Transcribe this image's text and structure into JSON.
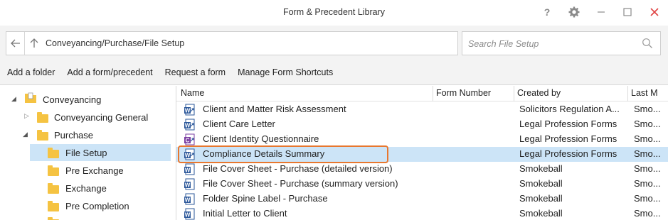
{
  "window": {
    "title": "Form & Precedent Library",
    "controls": [
      "help-icon",
      "gear-icon",
      "minimize-icon",
      "maximize-icon",
      "close-icon"
    ],
    "help_glyph": "?",
    "close_color": "#e04343"
  },
  "address": {
    "path": "Conveyancing/Purchase/File Setup"
  },
  "search": {
    "placeholder": "Search File Setup"
  },
  "actions": [
    "Add a folder",
    "Add a form/precedent",
    "Request a form",
    "Manage Form Shortcuts"
  ],
  "tree": [
    {
      "label": "Conveyancing",
      "expanded": true,
      "selected": false
    },
    {
      "label": "Conveyancing General",
      "expanded": false,
      "selected": false
    },
    {
      "label": "Purchase",
      "expanded": true,
      "selected": false
    },
    {
      "label": "File Setup",
      "selected": true
    },
    {
      "label": "Pre Exchange",
      "selected": false
    },
    {
      "label": "Exchange",
      "selected": false
    },
    {
      "label": "Pre Completion",
      "selected": false
    }
  ],
  "table": {
    "columns": [
      "Name",
      "Form Number",
      "Created by",
      "Last M"
    ],
    "rows": [
      {
        "name": "Client and Matter Risk Assessment",
        "form_number": "",
        "created_by": "Solicitors Regulation A...",
        "last": "Smo...",
        "icon": "word-link-icon",
        "selected": false
      },
      {
        "name": "Client Care Letter",
        "form_number": "",
        "created_by": "Legal Profession Forms",
        "last": "Smo...",
        "icon": "word-link-icon",
        "selected": false
      },
      {
        "name": "Client Identity Questionnaire",
        "form_number": "",
        "created_by": "Legal Profession Forms",
        "last": "Smo...",
        "icon": "form-link-icon",
        "selected": false
      },
      {
        "name": "Compliance Details Summary",
        "form_number": "",
        "created_by": "Legal Profession Forms",
        "last": "Smo...",
        "icon": "word-link-icon",
        "selected": true
      },
      {
        "name": "File Cover Sheet - Purchase (detailed version)",
        "form_number": "",
        "created_by": "Smokeball",
        "last": "Smo...",
        "icon": "word-icon",
        "selected": false
      },
      {
        "name": "File Cover Sheet - Purchase (summary version)",
        "form_number": "",
        "created_by": "Smokeball",
        "last": "Smo...",
        "icon": "word-icon",
        "selected": false
      },
      {
        "name": "Folder Spine Label - Purchase",
        "form_number": "",
        "created_by": "Smokeball",
        "last": "Smo...",
        "icon": "word-icon",
        "selected": false
      },
      {
        "name": "Initial Letter to Client",
        "form_number": "",
        "created_by": "Smokeball",
        "last": "Smo...",
        "icon": "word-icon",
        "selected": false
      }
    ]
  },
  "colors": {
    "selection": "#cce4f7",
    "highlight_border": "#e8772e",
    "word_blue": "#2b579a",
    "form_purple": "#7b3fa3",
    "folder": "#f5c342"
  }
}
